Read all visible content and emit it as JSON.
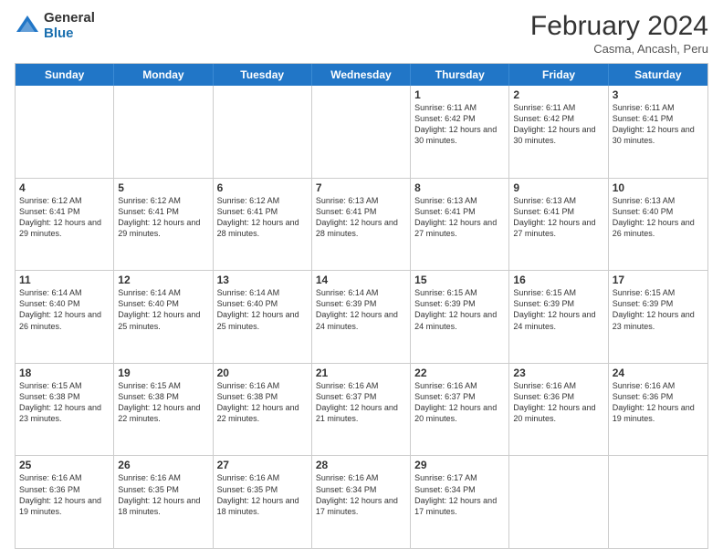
{
  "logo": {
    "general": "General",
    "blue": "Blue"
  },
  "title": "February 2024",
  "location": "Casma, Ancash, Peru",
  "days_of_week": [
    "Sunday",
    "Monday",
    "Tuesday",
    "Wednesday",
    "Thursday",
    "Friday",
    "Saturday"
  ],
  "weeks": [
    [
      {
        "day": "",
        "info": ""
      },
      {
        "day": "",
        "info": ""
      },
      {
        "day": "",
        "info": ""
      },
      {
        "day": "",
        "info": ""
      },
      {
        "day": "1",
        "info": "Sunrise: 6:11 AM\nSunset: 6:42 PM\nDaylight: 12 hours and 30 minutes."
      },
      {
        "day": "2",
        "info": "Sunrise: 6:11 AM\nSunset: 6:42 PM\nDaylight: 12 hours and 30 minutes."
      },
      {
        "day": "3",
        "info": "Sunrise: 6:11 AM\nSunset: 6:41 PM\nDaylight: 12 hours and 30 minutes."
      }
    ],
    [
      {
        "day": "4",
        "info": "Sunrise: 6:12 AM\nSunset: 6:41 PM\nDaylight: 12 hours and 29 minutes."
      },
      {
        "day": "5",
        "info": "Sunrise: 6:12 AM\nSunset: 6:41 PM\nDaylight: 12 hours and 29 minutes."
      },
      {
        "day": "6",
        "info": "Sunrise: 6:12 AM\nSunset: 6:41 PM\nDaylight: 12 hours and 28 minutes."
      },
      {
        "day": "7",
        "info": "Sunrise: 6:13 AM\nSunset: 6:41 PM\nDaylight: 12 hours and 28 minutes."
      },
      {
        "day": "8",
        "info": "Sunrise: 6:13 AM\nSunset: 6:41 PM\nDaylight: 12 hours and 27 minutes."
      },
      {
        "day": "9",
        "info": "Sunrise: 6:13 AM\nSunset: 6:41 PM\nDaylight: 12 hours and 27 minutes."
      },
      {
        "day": "10",
        "info": "Sunrise: 6:13 AM\nSunset: 6:40 PM\nDaylight: 12 hours and 26 minutes."
      }
    ],
    [
      {
        "day": "11",
        "info": "Sunrise: 6:14 AM\nSunset: 6:40 PM\nDaylight: 12 hours and 26 minutes."
      },
      {
        "day": "12",
        "info": "Sunrise: 6:14 AM\nSunset: 6:40 PM\nDaylight: 12 hours and 25 minutes."
      },
      {
        "day": "13",
        "info": "Sunrise: 6:14 AM\nSunset: 6:40 PM\nDaylight: 12 hours and 25 minutes."
      },
      {
        "day": "14",
        "info": "Sunrise: 6:14 AM\nSunset: 6:39 PM\nDaylight: 12 hours and 24 minutes."
      },
      {
        "day": "15",
        "info": "Sunrise: 6:15 AM\nSunset: 6:39 PM\nDaylight: 12 hours and 24 minutes."
      },
      {
        "day": "16",
        "info": "Sunrise: 6:15 AM\nSunset: 6:39 PM\nDaylight: 12 hours and 24 minutes."
      },
      {
        "day": "17",
        "info": "Sunrise: 6:15 AM\nSunset: 6:39 PM\nDaylight: 12 hours and 23 minutes."
      }
    ],
    [
      {
        "day": "18",
        "info": "Sunrise: 6:15 AM\nSunset: 6:38 PM\nDaylight: 12 hours and 23 minutes."
      },
      {
        "day": "19",
        "info": "Sunrise: 6:15 AM\nSunset: 6:38 PM\nDaylight: 12 hours and 22 minutes."
      },
      {
        "day": "20",
        "info": "Sunrise: 6:16 AM\nSunset: 6:38 PM\nDaylight: 12 hours and 22 minutes."
      },
      {
        "day": "21",
        "info": "Sunrise: 6:16 AM\nSunset: 6:37 PM\nDaylight: 12 hours and 21 minutes."
      },
      {
        "day": "22",
        "info": "Sunrise: 6:16 AM\nSunset: 6:37 PM\nDaylight: 12 hours and 20 minutes."
      },
      {
        "day": "23",
        "info": "Sunrise: 6:16 AM\nSunset: 6:36 PM\nDaylight: 12 hours and 20 minutes."
      },
      {
        "day": "24",
        "info": "Sunrise: 6:16 AM\nSunset: 6:36 PM\nDaylight: 12 hours and 19 minutes."
      }
    ],
    [
      {
        "day": "25",
        "info": "Sunrise: 6:16 AM\nSunset: 6:36 PM\nDaylight: 12 hours and 19 minutes."
      },
      {
        "day": "26",
        "info": "Sunrise: 6:16 AM\nSunset: 6:35 PM\nDaylight: 12 hours and 18 minutes."
      },
      {
        "day": "27",
        "info": "Sunrise: 6:16 AM\nSunset: 6:35 PM\nDaylight: 12 hours and 18 minutes."
      },
      {
        "day": "28",
        "info": "Sunrise: 6:16 AM\nSunset: 6:34 PM\nDaylight: 12 hours and 17 minutes."
      },
      {
        "day": "29",
        "info": "Sunrise: 6:17 AM\nSunset: 6:34 PM\nDaylight: 12 hours and 17 minutes."
      },
      {
        "day": "",
        "info": ""
      },
      {
        "day": "",
        "info": ""
      }
    ]
  ]
}
